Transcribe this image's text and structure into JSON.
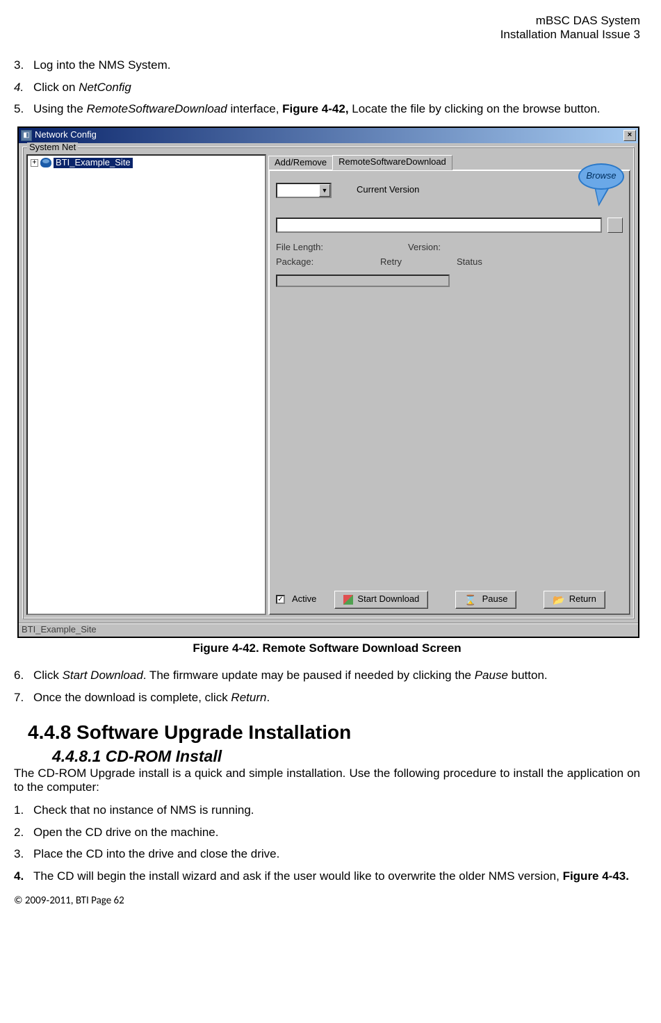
{
  "header": {
    "line1": "mBSC DAS System",
    "line2": "Installation Manual Issue 3"
  },
  "steps_top": [
    {
      "num": "3.",
      "text": "Log into the NMS System."
    },
    {
      "num": "4.",
      "prefix": "Click on ",
      "italic": "NetConfig",
      "num_italic": true
    },
    {
      "num": "5.",
      "part1": "Using the ",
      "italic1": "RemoteSoftwareDownload",
      "part2": " interface, ",
      "bold": "Figure 4-42,",
      "part3": " Locate the file by clicking on the browse button."
    }
  ],
  "screenshot": {
    "window_title": "Network Config",
    "groupbox_label": "System Net",
    "tree_item": "BTI_Example_Site",
    "tabs": {
      "tab1": "Add/Remove",
      "tab2": "RemoteSoftwareDownload"
    },
    "current_version_label": "Current Version",
    "file_length_label": "File Length:",
    "version_label": "Version:",
    "package_label": "Package:",
    "retry_label": "Retry",
    "status_label": "Status",
    "browse_callout": "Browse",
    "active_label": "Active",
    "start_download_btn": "Start Download",
    "pause_btn": "Pause",
    "return_btn": "Return",
    "statusbar": "BTI_Example_Site"
  },
  "figure_caption": "Figure 4-42. Remote Software Download Screen",
  "steps_mid": [
    {
      "num": "6.",
      "part1": "Click ",
      "italic1": "Start Download",
      "part2": ". The firmware update may be paused if needed by clicking the ",
      "italic2": "Pause",
      "part3": " button."
    },
    {
      "num": "7.",
      "part1": "Once the download is complete, click ",
      "italic1": "Return",
      "part2": "."
    }
  ],
  "section": {
    "h2": "4.4.8  Software Upgrade Installation",
    "h3_num": "4.4.8.1 ",
    "h3_title": "CD-ROM Install",
    "intro": "The CD-ROM Upgrade install is a quick and simple installation. Use the following procedure to install the application on to the computer:"
  },
  "steps_bottom": [
    {
      "num": "1.",
      "text": "Check that no instance of NMS is running."
    },
    {
      "num": "2.",
      "text": "Open the CD drive on the machine."
    },
    {
      "num": "3.",
      "text": "Place the CD into the drive and close the drive."
    },
    {
      "num": "4.",
      "bold_num": true,
      "part1": "The CD will begin the install wizard and ask if the user would like to overwrite the older NMS version, ",
      "bold": "Figure 4-43."
    }
  ],
  "footer": "© 2009‐2011, BTI Page 62"
}
